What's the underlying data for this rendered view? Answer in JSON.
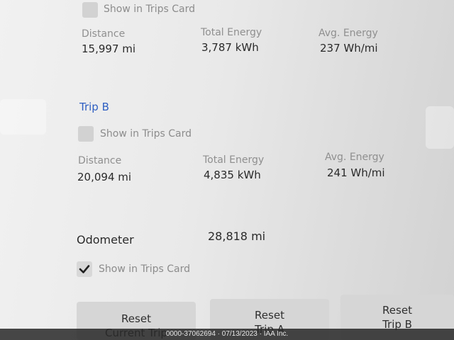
{
  "trip_a": {
    "show_in_trips_label": "Show in Trips Card",
    "distance_label": "Distance",
    "distance_value": "15,997 mi",
    "total_energy_label": "Total Energy",
    "total_energy_value": "3,787 kWh",
    "avg_energy_label": "Avg. Energy",
    "avg_energy_value": "237 Wh/mi"
  },
  "trip_b": {
    "title": "Trip B",
    "show_in_trips_label": "Show in Trips Card",
    "distance_label": "Distance",
    "distance_value": "20,094 mi",
    "total_energy_label": "Total Energy",
    "total_energy_value": "4,835 kWh",
    "avg_energy_label": "Avg. Energy",
    "avg_energy_value": "241 Wh/mi"
  },
  "odometer": {
    "label": "Odometer",
    "value": "28,818 mi",
    "show_in_trips_label": "Show in Trips Card",
    "checked": true
  },
  "buttons": {
    "reset_current_line1": "Reset",
    "reset_current_line2": "Current Trip",
    "reset_a_line1": "Reset",
    "reset_a_line2": "Trip A",
    "reset_b_line1": "Reset",
    "reset_b_line2": "Trip B"
  },
  "footer": {
    "watermark": "0000-37062694 · 07/13/2023 · IAA Inc."
  },
  "colors": {
    "accent_blue": "#2f5fc2"
  }
}
